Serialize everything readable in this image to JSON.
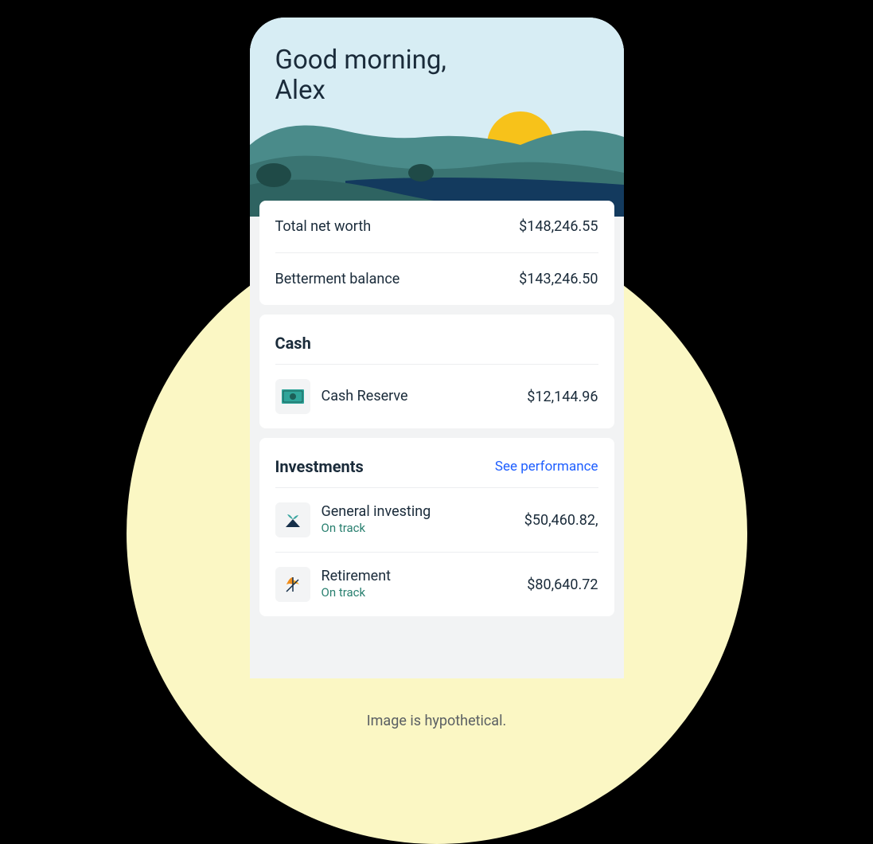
{
  "greeting": {
    "line1": "Good morning,",
    "line2": "Alex"
  },
  "summary": {
    "net_worth_label": "Total net worth",
    "net_worth_value": "$148,246.55",
    "balance_label": "Betterment balance",
    "balance_value": "$143,246.50"
  },
  "cash": {
    "title": "Cash",
    "items": [
      {
        "name": "Cash Reserve",
        "amount": "$12,144.96"
      }
    ]
  },
  "investments": {
    "title": "Investments",
    "link": "See performance",
    "items": [
      {
        "name": "General investing",
        "status": "On track",
        "amount": "$50,460.82,"
      },
      {
        "name": "Retirement",
        "status": "On track",
        "amount": "$80,640.72"
      }
    ]
  },
  "caption": "Image is hypothetical."
}
